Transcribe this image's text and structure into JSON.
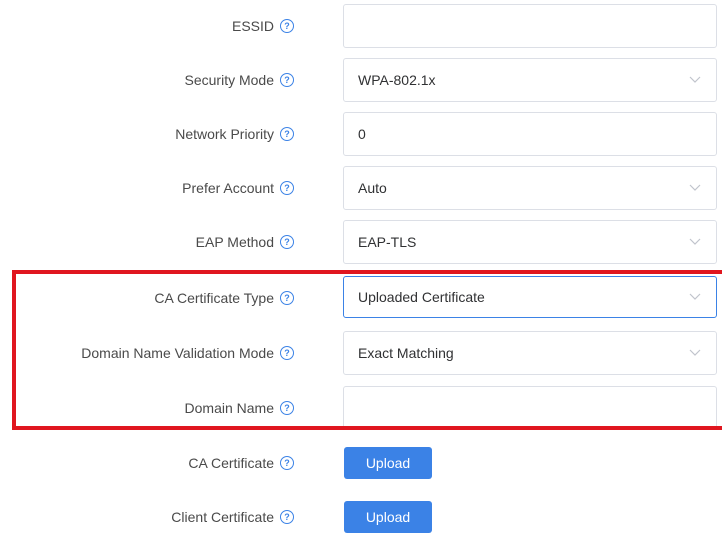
{
  "help_glyph": "?",
  "accent_color": "#3b82e6",
  "highlight_color": "#e0161f",
  "fields": {
    "essid": {
      "label": "ESSID",
      "value": ""
    },
    "security_mode": {
      "label": "Security Mode",
      "value": "WPA-802.1x"
    },
    "network_priority": {
      "label": "Network Priority",
      "value": "0"
    },
    "prefer_account": {
      "label": "Prefer Account",
      "value": "Auto"
    },
    "eap_method": {
      "label": "EAP Method",
      "value": "EAP-TLS"
    },
    "ca_certificate_type": {
      "label": "CA Certificate Type",
      "value": "Uploaded Certificate"
    },
    "domain_validation_mode": {
      "label": "Domain Name Validation Mode",
      "value": "Exact Matching"
    },
    "domain_name": {
      "label": "Domain Name",
      "value": ""
    },
    "ca_certificate": {
      "label": "CA Certificate",
      "button": "Upload"
    },
    "client_certificate": {
      "label": "Client Certificate",
      "button": "Upload"
    }
  }
}
